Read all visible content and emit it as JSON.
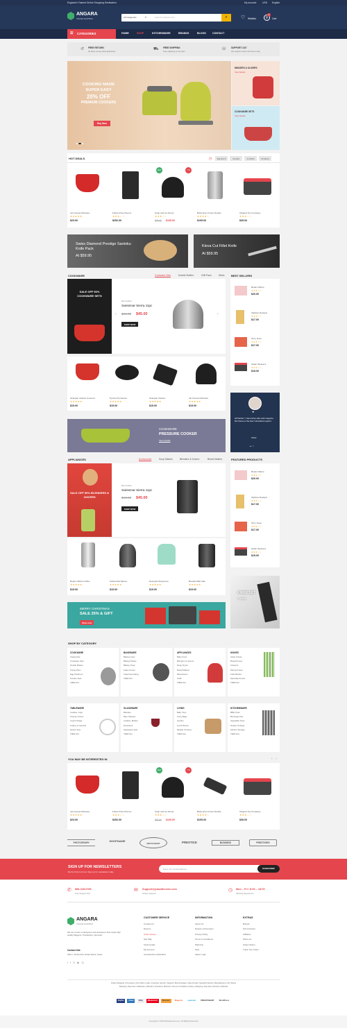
{
  "topbar": {
    "tagline": "England's Fastest Online Shopping Destination",
    "account": "My account",
    "currency": "USD",
    "language": "English"
  },
  "header": {
    "logo_name": "ANGARA",
    "logo_sub": "ONLINE SHOPPING",
    "search_category": "All Categories",
    "search_placeholder": "Search products here",
    "wishlist": "Wishlist",
    "cart": "Cart",
    "cart_count": "0"
  },
  "nav": {
    "categories": "CATEGORIES",
    "items": [
      "HOME",
      "SHOP",
      "KITCHENWARE",
      "BRANDS",
      "BLOGS",
      "CONTACT"
    ],
    "active": "SHOP"
  },
  "services": [
    {
      "title": "FREE RETURN",
      "desc": "30 Days money back guarantee"
    },
    {
      "title": "FREE SHIPPING",
      "desc": "Free shipping on all order"
    },
    {
      "title": "SUPPORT 24/7",
      "desc": "We support online 24 hours a day"
    }
  ],
  "hero": {
    "line1": "COOKING MADE",
    "line2": "SUPER EASY",
    "line3": "20% OFF",
    "line4": "PREMIUM COOKERS",
    "button": "Buy Now"
  },
  "side_banners": [
    {
      "title": "MINCERS & SLICERS",
      "link": "View Details"
    },
    {
      "title": "COOKWARE SETS",
      "link": "View Details"
    }
  ],
  "hot_deals": {
    "title": "HOT DEALS",
    "timer": [
      "999 DAYS",
      "09 HRS",
      "41 MINS",
      "35 SECS"
    ],
    "products": [
      {
        "name": "LE Creuset Moisture",
        "price": "$23.00",
        "old": ""
      },
      {
        "name": "Fisher-Price Rooms",
        "price": "$252.00",
        "old": ""
      },
      {
        "name": "Snap and Go Dump",
        "price": "$105.00",
        "old": "$32.00"
      },
      {
        "name": "Baby Emo Forest Noodle",
        "price": "$105.00",
        "old": ""
      },
      {
        "name": "Original Toy Company",
        "price": "$35.00",
        "old": ""
      }
    ]
  },
  "promo_banners": [
    {
      "title": "Swiss Diamond Prestige Santoku Knife Pack",
      "price": "At $59.95"
    },
    {
      "title": "Kleva Cut Fillet Knife",
      "price": "At $59.95"
    }
  ],
  "cookware": {
    "title": "COOKWARE",
    "tabs": [
      "Cookware Sets",
      "Double Boilers",
      "Grill Pans",
      "Woks"
    ],
    "banner": "SALE OFF 50% COOKWARE SETS",
    "featured": {
      "label": "Best Sellers",
      "name": "Swissmar Sierra 11pc",
      "old": "$48.00",
      "price": "$45.00",
      "button": "SHOP NOW"
    },
    "products": [
      {
        "name": "Scanpan Classic Covered",
        "price": "$15.00"
      },
      {
        "name": "Pyrolux Pyrostone",
        "price": "$15.00"
      },
      {
        "name": "Scanpan Classic",
        "price": "$15.00"
      },
      {
        "name": "LE Creuset Moisture",
        "price": "$15.00"
      }
    ],
    "pressure_banner": {
      "line1": "COOKWARE",
      "line2": "PRESSURE COOKER",
      "link": "View Details"
    }
  },
  "best_sellers": {
    "title": "BEST SELLERS",
    "items": [
      {
        "name": "Bodum Bistro",
        "price": "$20.00"
      },
      {
        "name": "Ogilvies Designs",
        "price": "$17.00"
      },
      {
        "name": "Terry Oven",
        "price": "$17.00"
      },
      {
        "name": "Glider Weavers",
        "price": "$15.00"
      }
    ]
  },
  "testimonial": {
    "text": "All Perfect ! I have three sites with magento, this theme is the best !! Excellent support.",
    "author": "Victor"
  },
  "appliances": {
    "title": "APPLIANCES",
    "tabs": [
      "Accessories",
      "Soup Makers",
      "Blenders & Juicers",
      "Bread Makers"
    ],
    "banner": "SALE OFF 50% BLENDERS & JUICERS",
    "featured": {
      "label": "Best Sellers",
      "name": "Swissmar Sierra 11pc",
      "old": "$48.00",
      "price": "$45.00",
      "button": "SHOP NOW"
    },
    "products": [
      {
        "name": "Bodum Bistro Coffee",
        "price": "$15.00"
      },
      {
        "name": "KitchenAid Siphon",
        "price": "$15.00"
      },
      {
        "name": "Delonghi Nespresso",
        "price": "$15.00"
      },
      {
        "name": "Breville Milk Cafe",
        "price": "$15.00"
      }
    ],
    "christmas_banner": {
      "line1": "MERRY CHRISTMAS",
      "line2": "SALE 25% & GIFT",
      "button": "Shop now"
    }
  },
  "featured_products": {
    "title": "FEATURED PRODUCTS",
    "items": [
      {
        "name": "Bodum Bistro",
        "price": "$20.00"
      },
      {
        "name": "Ogilvies Designs",
        "price": "$17.00"
      },
      {
        "name": "Terry Oven",
        "price": "$17.00"
      },
      {
        "name": "Glider Weavers",
        "price": "$15.00"
      }
    ],
    "knife_banner": {
      "line1": "KNIFE SET",
      "line2": "Cutlery"
    }
  },
  "shop_by_category": {
    "title": "SHOP BY CATEGORY",
    "groups": [
      {
        "title": "COOKWARE",
        "items": [
          "Casseroles",
          "Cookware Sets",
          "Double Boilers",
          "Frying Pans",
          "Egg Poachers",
          "Fondue Sets",
          "VIEW ALL"
        ]
      },
      {
        "title": "BAKEWARE",
        "items": [
          "Baking Cups",
          "Baking Dishes",
          "Baking Trays",
          "Cake Covers",
          "Cake Decorating",
          "VIEW ALL"
        ]
      },
      {
        "title": "APPLIANCES",
        "items": [
          "Baby Food",
          "Blenders & Juicers",
          "Deep Fryers",
          "Bread Makers",
          "Microwaves",
          "Grills",
          "VIEW ALL"
        ]
      },
      {
        "title": "KNIVES",
        "items": [
          "Asian Knives",
          "Bread Knives",
          "Cleavers",
          "Paring Knives",
          "Knife Blocks",
          "Specialty Knives",
          "VIEW ALL"
        ]
      },
      {
        "title": "TABLEWARE",
        "items": [
          "Carafes, Jugs",
          "Cheese Knives",
          "Cups & Mugs",
          "Cutlery & Utensils",
          "Dinner Sets",
          "VIEW ALL"
        ]
      },
      {
        "title": "GLASSWARE",
        "items": [
          "Barware",
          "Beer Glasses",
          "Carafes, Bottles",
          "Decanters",
          "Glassware Sets",
          "VIEW ALL"
        ]
      },
      {
        "title": "LIVING",
        "items": [
          "Baby Toys",
          "Carry Bags",
          "Garden",
          "Lunch Boxes",
          "Muskle Trinches",
          "VIEW ALL"
        ]
      },
      {
        "title": "KITCHENWARE",
        "items": [
          "BBQ Tools",
          "Beverage Kits",
          "Vegetable Tools",
          "Graters & Mugs",
          "Kitchen Storage",
          "VIEW ALL"
        ]
      }
    ]
  },
  "interested": {
    "title": "YOU MAY BE INTERESTED IN",
    "products": [
      {
        "name": "LE Creuset Moisture",
        "price": "$23.00",
        "old": ""
      },
      {
        "name": "Fisher-Price Rooms",
        "price": "$252.00",
        "old": ""
      },
      {
        "name": "Snap and Go Dump",
        "price": "$105.00",
        "old": "$32.00"
      },
      {
        "name": "Baby Emo Forest Noodle",
        "price": "$105.00",
        "old": ""
      },
      {
        "name": "Original Toy Company",
        "price": "$35.00",
        "old": ""
      }
    ]
  },
  "brands": [
    "PHOTOGRAPH",
    "SHOPNAME",
    "RESTAURANT",
    "PRESTICE",
    "BUSINESS",
    "PRESTIGES"
  ],
  "newsletter": {
    "title": "SIGN UP FOR NEWSLETTERS",
    "sub": "Be the First to Know. Sign up for newsletter today",
    "placeholder": "Enter Your Email Address",
    "button": "SUBSCRIBE"
  },
  "contact_strip": [
    {
      "main": "888-345-6789",
      "sub": "Free Support line!"
    },
    {
      "main": "Support@plazathemes.com",
      "sub": "Orders Support!"
    },
    {
      "main": "Mon – Fri / 8:00 – 18:00",
      "sub": "Working Days/Hours"
    }
  ],
  "footer": {
    "about": "We are a team of designers and developers that create high quality Magento, Prestashop, Opencart.",
    "contact_label": "Contact Info",
    "address": "189-C, Technohub, Dubai Silicon Oasis.",
    "columns": [
      {
        "title": "CUSTOMER SERVICE",
        "items": [
          "Contact Us",
          "Returns",
          "Order History",
          "Site Map",
          "Testimonials",
          "My Account",
          "Unsubscribe Notification"
        ]
      },
      {
        "title": "INFORMATION",
        "items": [
          "About Us",
          "Delivery Information",
          "Privacy Policy",
          "Terms & Conditions",
          "Warranty",
          "FAQ",
          "Seller Login"
        ]
      },
      {
        "title": "EXTRAS",
        "items": [
          "Brands",
          "Gift Vouchers",
          "Affiliates",
          "Wish List",
          "Order History",
          "Track Your Order"
        ]
      }
    ],
    "links_line1": "Online Shopping | Promotions | My Orders | Help | Customer Service | Support | Most Populars | New Arrivals | Special Products | Manufacturers | Our Stores",
    "links_line2": "Shipping | Payments | Warantee | Refunds | Checkout | Discount | Terms & Conditions | Policy | Shipping | Payments | Returns | Refunds",
    "payments": [
      "PayPal",
      "Amex",
      "VISA",
      "Mastercard",
      "Discover",
      "Magento",
      "opencart",
      "PRESTASHOP",
      "WordPress"
    ],
    "copyright": "Copyright © 2016 Plazathemes.com. All Rights Reserved"
  },
  "colors": {
    "accent": "#e5454d",
    "navy": "#263859"
  }
}
